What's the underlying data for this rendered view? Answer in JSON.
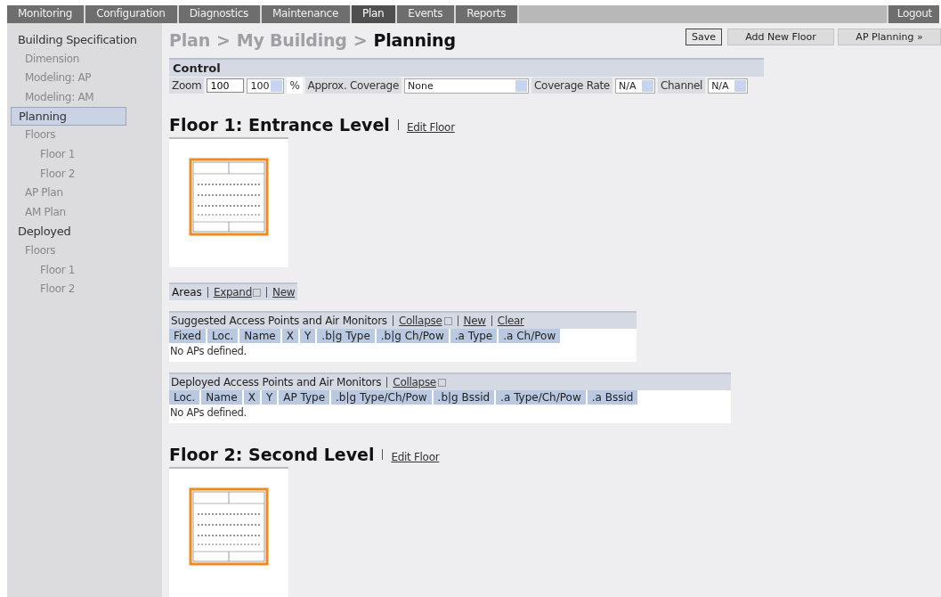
{
  "nav_tabs": [
    {
      "label": "Monitoring",
      "selected": false
    },
    {
      "label": "Configuration",
      "selected": false
    },
    {
      "label": "Diagnostics",
      "selected": false
    },
    {
      "label": "Maintenance",
      "selected": false
    },
    {
      "label": "Plan",
      "selected": true
    },
    {
      "label": "Events",
      "selected": false
    },
    {
      "label": "Reports",
      "selected": false
    }
  ],
  "logout": "Logout",
  "sidebar": {
    "items": [
      {
        "label": "Building Specification",
        "selected": false,
        "children": [
          {
            "label": "Dimension",
            "selected": false
          },
          {
            "label": "Modeling: AP",
            "selected": false
          },
          {
            "label": "Modeling: AM",
            "selected": false
          }
        ]
      },
      {
        "label": "Planning",
        "selected": true,
        "children": [
          {
            "label": "Floors",
            "selected": false,
            "children": [
              {
                "label": "Floor 1",
                "selected": false
              },
              {
                "label": "Floor 2",
                "selected": false
              }
            ]
          },
          {
            "label": "AP Plan",
            "selected": false
          },
          {
            "label": "AM Plan",
            "selected": false
          }
        ]
      },
      {
        "label": "Deployed",
        "selected": false,
        "children": [
          {
            "label": "Floors",
            "selected": false,
            "children": [
              {
                "label": "Floor 1",
                "selected": false
              },
              {
                "label": "Floor 2",
                "selected": false
              }
            ]
          }
        ]
      }
    ]
  },
  "breadcrumb": {
    "parents": [
      "Plan",
      "My Building"
    ],
    "separator": ">",
    "current": "Planning"
  },
  "buttons": [
    "Save",
    "Add New Floor",
    "AP Planning »"
  ],
  "control": {
    "title": "Control",
    "zoom_label": "Zoom",
    "zoom_value": "100",
    "zoom_select": "100",
    "percent": "%",
    "coverage_label": "Approx. Coverage",
    "coverage_value": "None",
    "rate_label": "Coverage Rate",
    "rate_value": "N/A",
    "channel_label": "Channel",
    "channel_value": "N/A"
  },
  "floors": [
    {
      "title": "Floor 1: Entrance Level",
      "edit_link": "Edit Floor",
      "areas": {
        "title": "Areas",
        "links": [
          "Expand",
          "New"
        ]
      },
      "suggested": {
        "title": "Suggested Access Points and Air Monitors",
        "links": [
          {
            "label": "Collapse",
            "icon": true
          },
          {
            "label": "New",
            "icon": false
          },
          {
            "label": "Clear",
            "icon": false
          }
        ],
        "columns": [
          "Fixed",
          "Loc.",
          "Name",
          "X",
          "Y",
          ".b|g Type",
          ".b|g Ch/Pow",
          ".a Type",
          ".a Ch/Pow"
        ],
        "empty": "No APs defined."
      },
      "deployed": {
        "title": "Deployed Access Points and Air Monitors",
        "links": [
          {
            "label": "Collapse",
            "icon": true
          }
        ],
        "columns": [
          "Loc.",
          "Name",
          "X",
          "Y",
          "AP Type",
          ".b|g Type/Ch/Pow",
          ".b|g Bssid",
          ".a Type/Ch/Pow",
          ".a Bssid"
        ],
        "empty": "No APs defined."
      }
    },
    {
      "title": "Floor 2: Second Level",
      "edit_link": "Edit Floor"
    }
  ]
}
